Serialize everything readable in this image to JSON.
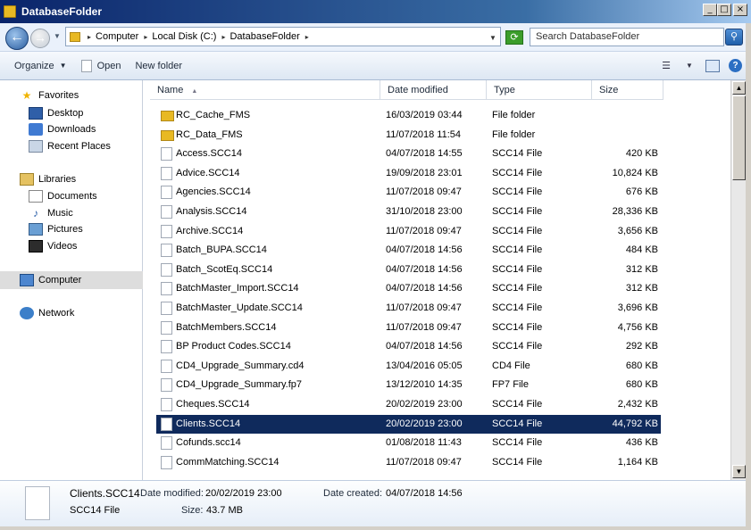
{
  "window": {
    "title": "DatabaseFolder",
    "controls": {
      "minimize": "_",
      "maximize": "□",
      "close": "×"
    }
  },
  "address": {
    "breadcrumbs": [
      "Computer",
      "Local Disk (C:)",
      "DatabaseFolder"
    ],
    "search_placeholder": "Search DatabaseFolder"
  },
  "toolbar": {
    "organize": "Organize",
    "open": "Open",
    "new_folder": "New folder"
  },
  "nav": {
    "favorites": {
      "label": "Favorites",
      "items": [
        "Desktop",
        "Downloads",
        "Recent Places"
      ]
    },
    "libraries": {
      "label": "Libraries",
      "items": [
        "Documents",
        "Music",
        "Pictures",
        "Videos"
      ]
    },
    "computer": "Computer",
    "network": "Network"
  },
  "columns": {
    "name": "Name",
    "date": "Date modified",
    "type": "Type",
    "size": "Size"
  },
  "files": [
    {
      "name": "RC_Cache_FMS",
      "date": "16/03/2019 03:44",
      "type": "File folder",
      "size": "",
      "kind": "folder"
    },
    {
      "name": "RC_Data_FMS",
      "date": "11/07/2018 11:54",
      "type": "File folder",
      "size": "",
      "kind": "folder"
    },
    {
      "name": "Access.SCC14",
      "date": "04/07/2018 14:55",
      "type": "SCC14 File",
      "size": "420 KB",
      "kind": "file"
    },
    {
      "name": "Advice.SCC14",
      "date": "19/09/2018 23:01",
      "type": "SCC14 File",
      "size": "10,824 KB",
      "kind": "file"
    },
    {
      "name": "Agencies.SCC14",
      "date": "11/07/2018 09:47",
      "type": "SCC14 File",
      "size": "676 KB",
      "kind": "file"
    },
    {
      "name": "Analysis.SCC14",
      "date": "31/10/2018 23:00",
      "type": "SCC14 File",
      "size": "28,336 KB",
      "kind": "file"
    },
    {
      "name": "Archive.SCC14",
      "date": "11/07/2018 09:47",
      "type": "SCC14 File",
      "size": "3,656 KB",
      "kind": "file"
    },
    {
      "name": "Batch_BUPA.SCC14",
      "date": "04/07/2018 14:56",
      "type": "SCC14 File",
      "size": "484 KB",
      "kind": "file"
    },
    {
      "name": "Batch_ScotEq.SCC14",
      "date": "04/07/2018 14:56",
      "type": "SCC14 File",
      "size": "312 KB",
      "kind": "file"
    },
    {
      "name": "BatchMaster_Import.SCC14",
      "date": "04/07/2018 14:56",
      "type": "SCC14 File",
      "size": "312 KB",
      "kind": "file"
    },
    {
      "name": "BatchMaster_Update.SCC14",
      "date": "11/07/2018 09:47",
      "type": "SCC14 File",
      "size": "3,696 KB",
      "kind": "file"
    },
    {
      "name": "BatchMembers.SCC14",
      "date": "11/07/2018 09:47",
      "type": "SCC14 File",
      "size": "4,756 KB",
      "kind": "file"
    },
    {
      "name": "BP Product Codes.SCC14",
      "date": "04/07/2018 14:56",
      "type": "SCC14 File",
      "size": "292 KB",
      "kind": "file"
    },
    {
      "name": "CD4_Upgrade_Summary.cd4",
      "date": "13/04/2016 05:05",
      "type": "CD4 File",
      "size": "680 KB",
      "kind": "file"
    },
    {
      "name": "CD4_Upgrade_Summary.fp7",
      "date": "13/12/2010 14:35",
      "type": "FP7 File",
      "size": "680 KB",
      "kind": "file"
    },
    {
      "name": "Cheques.SCC14",
      "date": "20/02/2019 23:00",
      "type": "SCC14 File",
      "size": "2,432 KB",
      "kind": "file"
    },
    {
      "name": "Clients.SCC14",
      "date": "20/02/2019 23:00",
      "type": "SCC14 File",
      "size": "44,792 KB",
      "kind": "file",
      "selected": true
    },
    {
      "name": "Cofunds.scc14",
      "date": "01/08/2018 11:43",
      "type": "SCC14 File",
      "size": "436 KB",
      "kind": "file"
    },
    {
      "name": "CommMatching.SCC14",
      "date": "11/07/2018 09:47",
      "type": "SCC14 File",
      "size": "1,164 KB",
      "kind": "file"
    }
  ],
  "details": {
    "name": "Clients.SCC14",
    "type": "SCC14 File",
    "modified_label": "Date modified:",
    "modified": "20/02/2019 23:00",
    "created_label": "Date created:",
    "created": "04/07/2018 14:56",
    "size_label": "Size:",
    "size": "43.7 MB"
  }
}
